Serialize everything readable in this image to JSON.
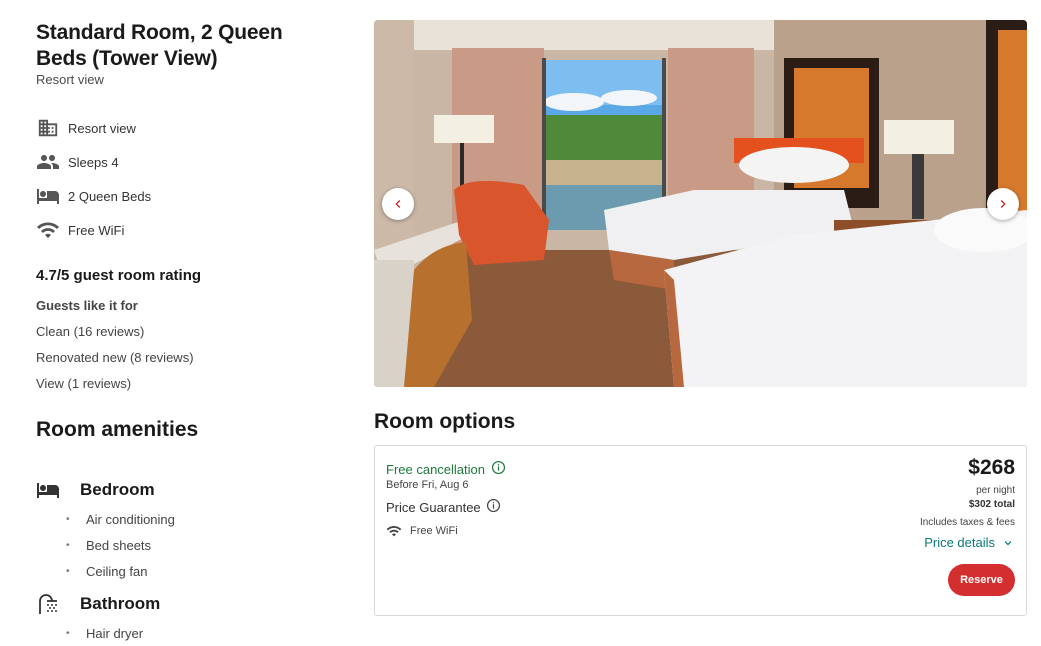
{
  "room": {
    "title": "Standard Room, 2 Queen Beds (Tower View)",
    "subtitle": "Resort view",
    "features": [
      {
        "icon": "building-icon",
        "label": "Resort view"
      },
      {
        "icon": "people-icon",
        "label": "Sleeps 4"
      },
      {
        "icon": "bed-icon",
        "label": "2 Queen Beds"
      },
      {
        "icon": "wifi-icon",
        "label": "Free WiFi"
      }
    ],
    "rating": "4.7/5 guest room rating",
    "guests_like_label": "Guests like it for",
    "reviews": [
      "Clean (16 reviews)",
      "Renovated new (8 reviews)",
      "View (1 reviews)"
    ]
  },
  "amenities": {
    "title": "Room amenities",
    "categories": [
      {
        "icon": "bed-icon",
        "name": "Bedroom",
        "items": [
          "Air conditioning",
          "Bed sheets",
          "Ceiling fan"
        ]
      },
      {
        "icon": "shower-icon",
        "name": "Bathroom",
        "items": [
          "Hair dryer"
        ]
      }
    ]
  },
  "gallery": {
    "prev_icon": "chevron-left-icon",
    "next_icon": "chevron-right-icon"
  },
  "options": {
    "title": "Room options",
    "card": {
      "free_cancellation": "Free cancellation",
      "cancel_before": "Before Fri, Aug 6",
      "price_guarantee": "Price Guarantee",
      "wifi": "Free WiFi",
      "price": "$268",
      "per_night": "per night",
      "total": "$302 total",
      "taxes": "Includes taxes & fees",
      "price_details": "Price details",
      "reserve": "Reserve"
    }
  },
  "colors": {
    "green": "#1d7a3a",
    "teal_link": "#0b7a7a",
    "reserve_red": "#d32f2f"
  }
}
